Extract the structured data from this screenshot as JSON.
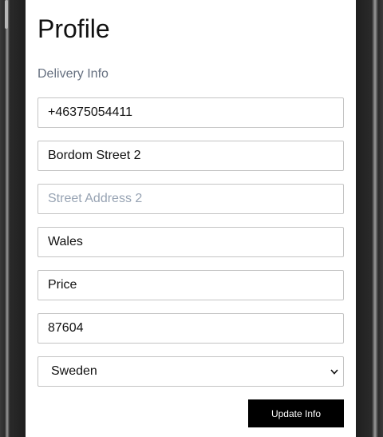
{
  "page": {
    "title": "Profile",
    "section_label": "Delivery Info"
  },
  "form": {
    "phone": {
      "value": "+46375054411",
      "placeholder": ""
    },
    "street1": {
      "value": "Bordom Street 2",
      "placeholder": ""
    },
    "street2": {
      "value": "",
      "placeholder": "Street Address 2"
    },
    "city": {
      "value": "Wales",
      "placeholder": ""
    },
    "region": {
      "value": "Price",
      "placeholder": ""
    },
    "postal": {
      "value": "87604",
      "placeholder": ""
    },
    "country": {
      "selected": "Sweden"
    },
    "submit_label": "Update Info"
  },
  "colors": {
    "button_bg": "#000000",
    "placeholder": "#97a3b3",
    "subtitle": "#667080"
  }
}
